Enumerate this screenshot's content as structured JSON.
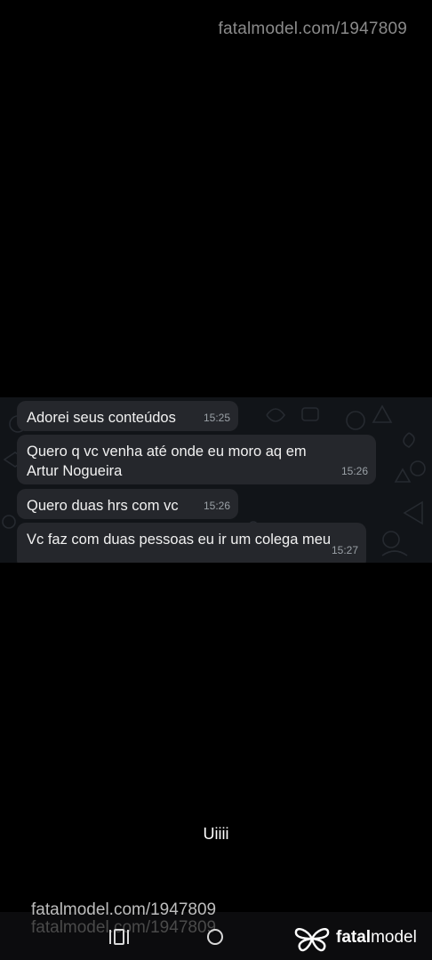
{
  "watermark": {
    "top_text": "fatalmodel.com/1947809",
    "bottom_text": "fatalmodel.com/1947809",
    "bottom_text_ghost": "fatalmodel.com/1947809"
  },
  "chat": {
    "messages": [
      {
        "text": "Adorei seus conteúdos",
        "time": "15:25"
      },
      {
        "text": "Quero q vc venha até onde eu moro aq em\nArtur Nogueira",
        "time": "15:26"
      },
      {
        "text": "Quero duas hrs com vc",
        "time": "15:26"
      },
      {
        "text": "Vc faz com duas pessoas eu ir um colega meu",
        "time": "15:27"
      }
    ]
  },
  "caption": "Uiiii",
  "brand": {
    "name_bold": "fatal",
    "name_regular": "model"
  },
  "navbar": {
    "buttons": [
      "recents-icon",
      "home-icon"
    ]
  }
}
